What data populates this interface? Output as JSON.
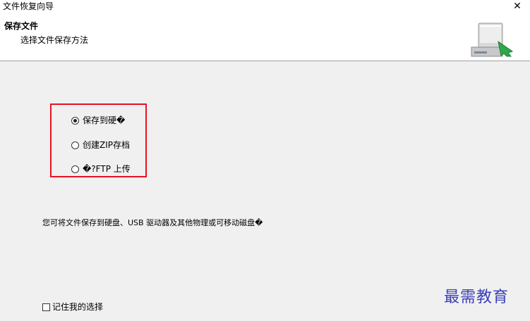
{
  "window": {
    "title": "文件恢复向导",
    "close_icon": "close-icon",
    "close_glyph": "✕"
  },
  "header": {
    "title": "保存文件",
    "subtitle": "选择文件保存方法",
    "icon": "hard-drive-with-green-arrow-icon"
  },
  "options": [
    {
      "label": "保存到硬�",
      "selected": true
    },
    {
      "label": "创建ZIP存档",
      "selected": false
    },
    {
      "label": "�?FTP 上传",
      "selected": false
    }
  ],
  "description": "您可将文件保存到硬盘、USB 驱动器及其他物理或可移动磁盘�",
  "remember": {
    "label": "记住我的选择",
    "checked": false
  },
  "watermark": "最需教育",
  "colors": {
    "highlight_border": "#e81123",
    "watermark": "#3b3fb7",
    "dialog_bg": "#f0f0f0",
    "header_bg": "#ffffff"
  }
}
